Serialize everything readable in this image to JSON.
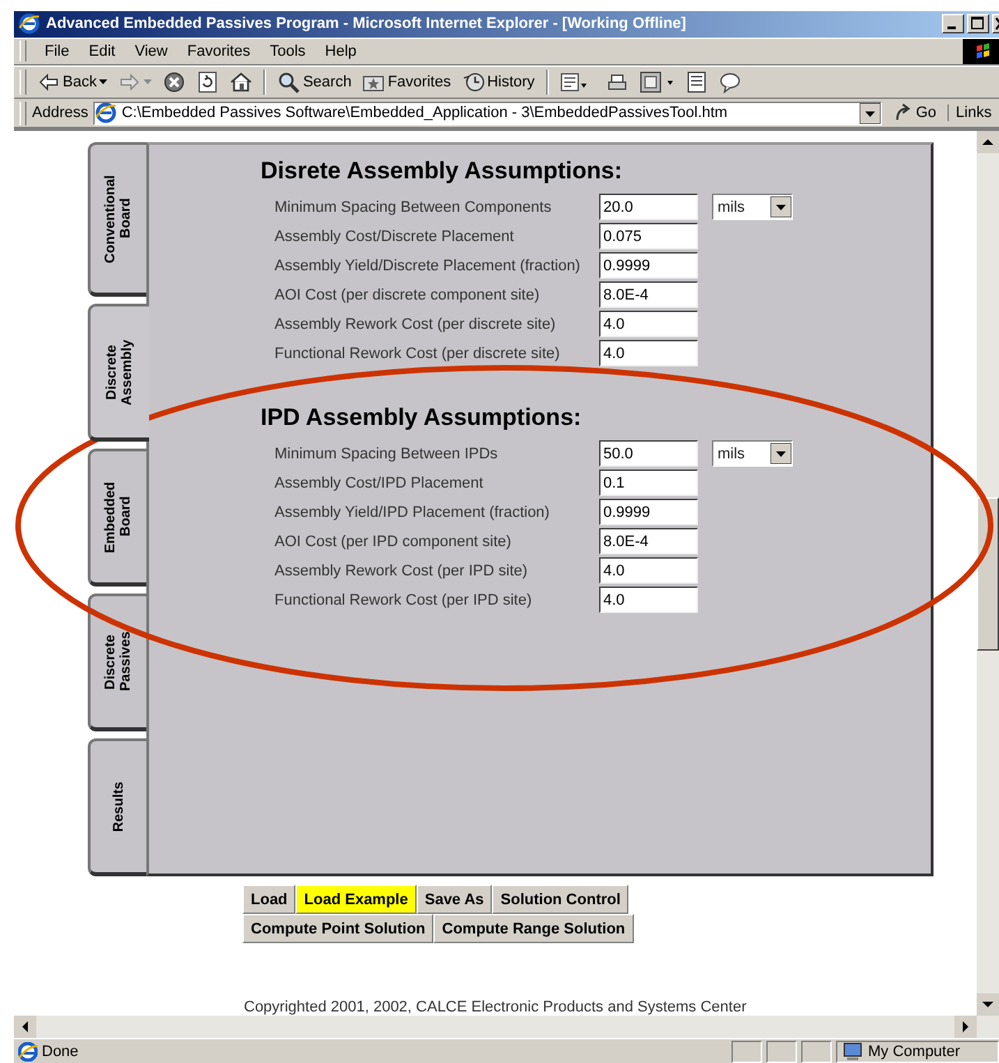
{
  "window": {
    "title": "Advanced Embedded Passives Program - Microsoft Internet Explorer - [Working Offline]"
  },
  "menu": [
    "File",
    "Edit",
    "View",
    "Favorites",
    "Tools",
    "Help"
  ],
  "toolbar": [
    {
      "kind": "back",
      "label": "Back"
    },
    {
      "kind": "forward"
    },
    {
      "kind": "stop"
    },
    {
      "kind": "refresh"
    },
    {
      "kind": "home"
    },
    {
      "kind": "search",
      "label": "Search"
    },
    {
      "kind": "favorites",
      "label": "Favorites"
    },
    {
      "kind": "history",
      "label": "History"
    },
    {
      "kind": "mail"
    },
    {
      "kind": "print"
    },
    {
      "kind": "edit"
    },
    {
      "kind": "doc"
    },
    {
      "kind": "discuss"
    }
  ],
  "address": {
    "label": "Address",
    "value": "C:\\Embedded Passives Software\\Embedded_Application - 3\\EmbeddedPassivesTool.htm",
    "go": "Go",
    "links": "Links"
  },
  "tabs": [
    {
      "label": "Conventional Board",
      "selected": false
    },
    {
      "label": "Discrete Assembly",
      "selected": true
    },
    {
      "label": "Embedded Board",
      "selected": false
    },
    {
      "label": "Discrete Passives",
      "selected": false
    },
    {
      "label": "Results",
      "selected": false
    }
  ],
  "sections": [
    {
      "title": "Disrete Assembly Assumptions:",
      "fields": [
        {
          "label": "Minimum Spacing Between Components",
          "value": "20.0",
          "unit": "mils"
        },
        {
          "label": "Assembly Cost/Discrete Placement",
          "value": "0.075"
        },
        {
          "label": "Assembly Yield/Discrete Placement (fraction)",
          "value": "0.9999"
        },
        {
          "label": "AOI Cost (per discrete component site)",
          "value": "8.0E-4"
        },
        {
          "label": "Assembly Rework Cost (per discrete site)",
          "value": "4.0"
        },
        {
          "label": "Functional Rework Cost (per discrete site)",
          "value": "4.0"
        }
      ]
    },
    {
      "title": "IPD Assembly Assumptions:",
      "fields": [
        {
          "label": "Minimum Spacing Between IPDs",
          "value": "50.0",
          "unit": "mils"
        },
        {
          "label": "Assembly Cost/IPD Placement",
          "value": "0.1"
        },
        {
          "label": "Assembly Yield/IPD Placement (fraction)",
          "value": "0.9999"
        },
        {
          "label": "AOI Cost (per IPD component site)",
          "value": "8.0E-4"
        },
        {
          "label": "Assembly Rework Cost (per IPD site)",
          "value": "4.0"
        },
        {
          "label": "Functional Rework Cost (per IPD site)",
          "value": "4.0"
        }
      ]
    }
  ],
  "buttons": [
    [
      {
        "label": "Load",
        "highlighted": false
      },
      {
        "label": "Load Example",
        "highlighted": true
      },
      {
        "label": "Save As",
        "highlighted": false
      },
      {
        "label": "Solution Control",
        "highlighted": false
      }
    ],
    [
      {
        "label": "Compute Point Solution",
        "highlighted": false
      },
      {
        "label": "Compute Range Solution",
        "highlighted": false
      }
    ]
  ],
  "copyright": "Copyrighted 2001, 2002, CALCE Electronic Products and Systems Center",
  "status_bar": {
    "text": "Done",
    "zone": "My Computer"
  }
}
